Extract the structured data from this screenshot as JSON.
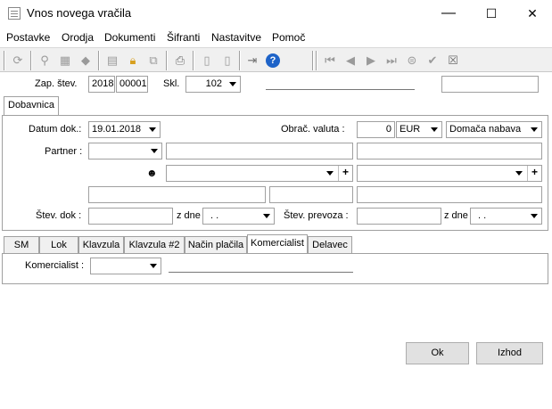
{
  "window": {
    "title": "Vnos novega vračila",
    "minimize": "—",
    "maximize": "☐",
    "close": "✕"
  },
  "menu": [
    "Postavke",
    "Orodja",
    "Dokumenti",
    "Šifranti",
    "Nastavitve",
    "Pomoč"
  ],
  "header": {
    "zap_label": "Zap. štev.",
    "year": "2018",
    "number": "00001",
    "skl_label": "Skl.",
    "skl_value": "102"
  },
  "main_tab": "Dobavnica",
  "form": {
    "datum_label": "Datum dok.:",
    "datum_value": "19.01.2018",
    "valuta_label": "Obrač. valuta :",
    "valuta_amount": "0",
    "valuta_code": "EUR",
    "nabava": "Domača nabava",
    "partner_label": "Partner :",
    "stev_dok_label": "Štev. dok :",
    "z_dne_1": "z dne",
    "date_placeholder_1": ". .",
    "stev_prevoza_label": "Štev. prevoza :",
    "z_dne_2": "z dne",
    "date_placeholder_2": ". ."
  },
  "sub_tabs": [
    "SM",
    "Lok",
    "Klavzula",
    "Klavzula #2",
    "Način plačila",
    "Komercialist",
    "Delavec"
  ],
  "sub_active": "Komercialist",
  "komercialist_label": "Komercialist :",
  "buttons": {
    "ok": "Ok",
    "izhod": "Izhod"
  },
  "icons": {
    "toolbar": [
      "refresh-icon",
      "pin-icon",
      "save-icon",
      "eraser-icon",
      "calculator-icon",
      "lock-icon",
      "copy-icon",
      "print-icon",
      "page-icon",
      "page2-icon",
      "exit-icon",
      "help-icon",
      "first-icon",
      "prev-icon",
      "next-icon",
      "last-icon",
      "up-icon",
      "check-icon",
      "cancel-icon"
    ]
  }
}
